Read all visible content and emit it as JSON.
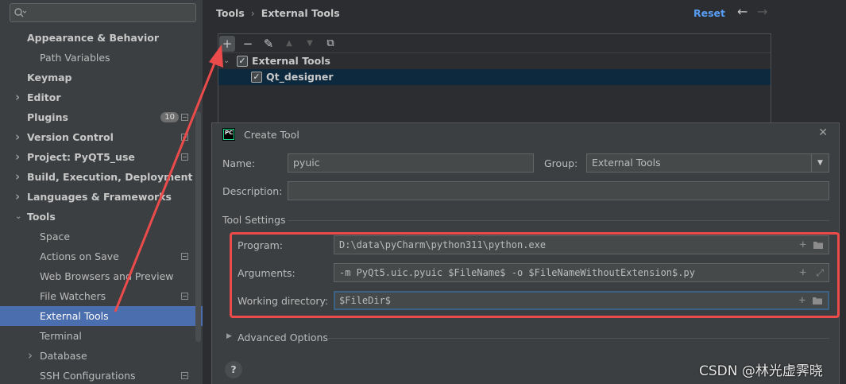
{
  "sidebar": {
    "search_placeholder": "",
    "items": [
      {
        "label": "Appearance & Behavior",
        "bold": true,
        "chevron": ""
      },
      {
        "label": "Path Variables"
      },
      {
        "label": "Keymap",
        "bold": true
      },
      {
        "label": "Editor",
        "bold": true,
        "chevron": "›"
      },
      {
        "label": "Plugins",
        "bold": true,
        "badge": "10"
      },
      {
        "label": "Version Control",
        "bold": true,
        "chevron": "›"
      },
      {
        "label": "Project: PyQT5_use",
        "bold": true,
        "chevron": "›"
      },
      {
        "label": "Build, Execution, Deployment",
        "bold": true,
        "chevron": "›"
      },
      {
        "label": "Languages & Frameworks",
        "bold": true,
        "chevron": "›"
      },
      {
        "label": "Tools",
        "bold": true,
        "chevron": "⌄"
      },
      {
        "label": "Space"
      },
      {
        "label": "Actions on Save"
      },
      {
        "label": "Web Browsers and Preview"
      },
      {
        "label": "File Watchers"
      },
      {
        "label": "External Tools",
        "selected": true
      },
      {
        "label": "Terminal"
      },
      {
        "label": "Database",
        "chevron": "›"
      },
      {
        "label": "SSH Configurations"
      }
    ]
  },
  "header": {
    "breadcrumb": [
      "Tools",
      "External Tools"
    ],
    "breadcrumb_sep": "›",
    "reset_label": "Reset",
    "back_icon": "←",
    "forward_icon": "→"
  },
  "toolbar": {
    "add": "+",
    "remove": "−",
    "edit": "✎",
    "up": "▲",
    "down": "▼",
    "copy": "⧉"
  },
  "tools_tree": {
    "group": "External Tools",
    "item": "Qt_designer"
  },
  "dialog": {
    "title": "Create Tool",
    "logo_text": "PC",
    "close": "✕",
    "name_label": "Name:",
    "name_value": "pyuic",
    "group_label": "Group:",
    "group_value": "External Tools",
    "description_label": "Description:",
    "description_value": "",
    "tool_settings_title": "Tool Settings",
    "program_label": "Program:",
    "program_value": "D:\\data\\pyCharm\\python311\\python.exe",
    "arguments_label": "Arguments:",
    "arguments_value": "-m PyQt5.uic.pyuic $FileName$ -o $FileNameWithoutExtension$.py",
    "workdir_label": "Working directory:",
    "workdir_value": "$FileDir$",
    "advanced_label": "Advanced Options",
    "help": "?"
  },
  "watermark": "CSDN @林光虚霁晓",
  "colors": {
    "accent": "#4b6eaf",
    "link": "#589df6",
    "highlight_box": "#ec4b4b",
    "annotation_arrow": "#ec4b4b"
  }
}
